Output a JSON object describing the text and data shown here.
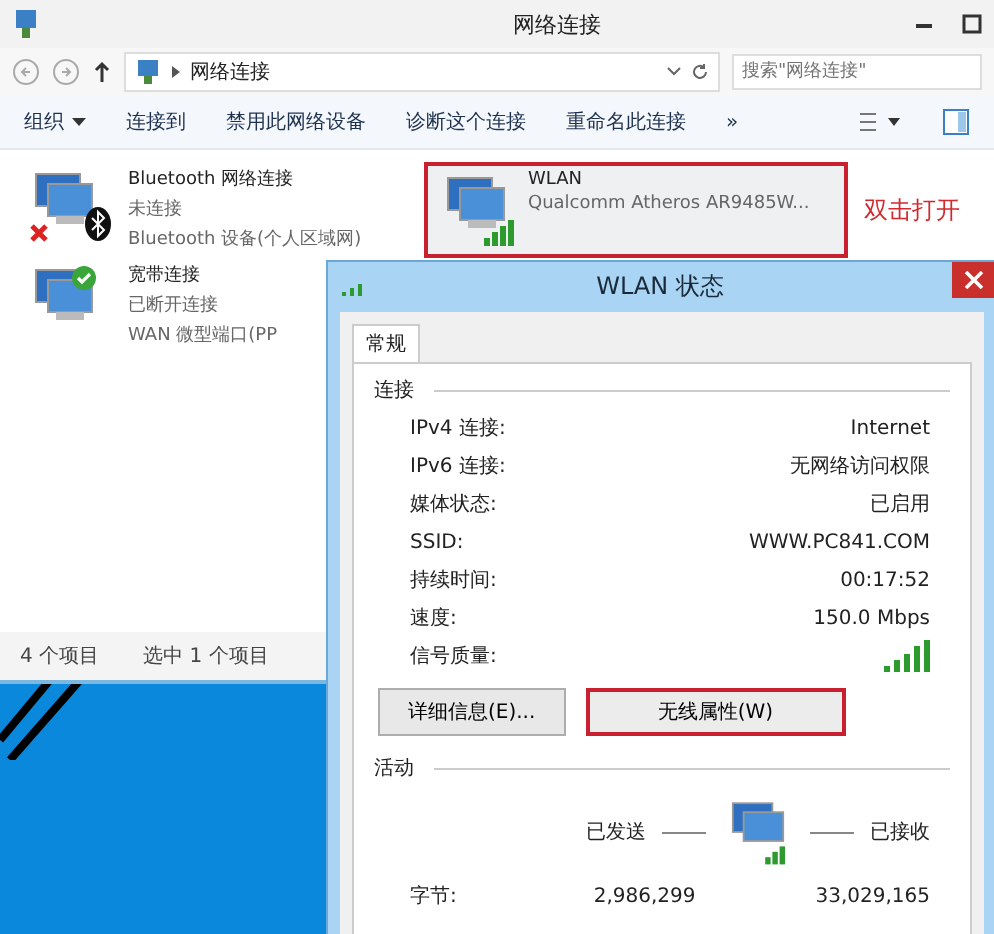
{
  "explorer": {
    "title": "网络连接",
    "address": "网络连接",
    "search": {
      "placeholder": "搜索\"网络连接\""
    },
    "toolbar": [
      {
        "label": "组织",
        "dropdown": true
      },
      {
        "label": "连接到",
        "dropdown": false
      },
      {
        "label": "禁用此网络设备",
        "dropdown": false
      },
      {
        "label": "诊断这个连接",
        "dropdown": false
      },
      {
        "label": "重命名此连接",
        "dropdown": false
      },
      {
        "label": "»",
        "dropdown": false
      }
    ],
    "connections": [
      {
        "name": "Bluetooth 网络连接",
        "status": "未连接",
        "device": "Bluetooth 设备(个人区域网)",
        "kind": "bluetooth",
        "selected": false
      },
      {
        "name": "WLAN",
        "device": "Qualcomm Atheros AR9485W...",
        "kind": "wifi",
        "selected": true
      },
      {
        "name": "宽带连接",
        "status": "已断开连接",
        "device": "WAN 微型端口(PP",
        "kind": "broadband",
        "selected": false
      }
    ],
    "annotation": "双击打开",
    "status_bar": [
      "4 个项目",
      "选中 1 个项目"
    ]
  },
  "dialog": {
    "title": "WLAN 状态",
    "tab": "常规",
    "connection_heading": "连接",
    "fields": [
      {
        "label": "IPv4 连接:",
        "value": "Internet"
      },
      {
        "label": "IPv6 连接:",
        "value": "无网络访问权限"
      },
      {
        "label": "媒体状态:",
        "value": "已启用"
      },
      {
        "label": "SSID:",
        "value": "WWW.PC841.COM"
      },
      {
        "label": "持续时间:",
        "value": "00:17:52"
      },
      {
        "label": "速度:",
        "value": "150.0 Mbps"
      }
    ],
    "signal_label": "信号质量:",
    "buttons": [
      {
        "label": "详细信息(E)...",
        "highlighted": false
      },
      {
        "label": "无线属性(W)",
        "highlighted": true
      }
    ],
    "activity_heading": "活动",
    "sent": "已发送",
    "received": "已接收",
    "bytes": {
      "label": "字节:",
      "sent": "2,986,299",
      "received": "33,029,165"
    }
  }
}
